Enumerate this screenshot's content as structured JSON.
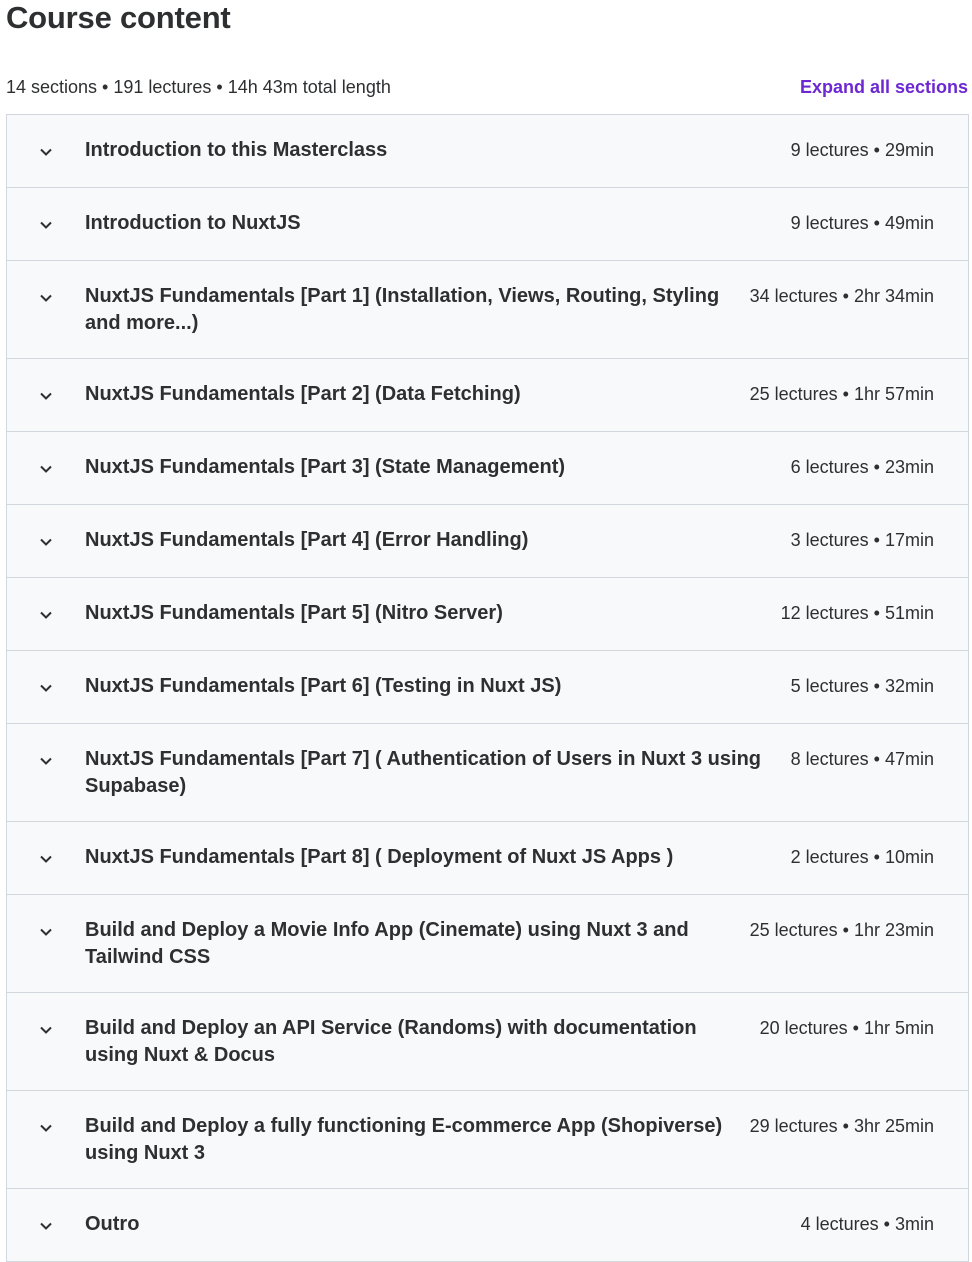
{
  "header": {
    "title": "Course content",
    "summary": "14 sections • 191 lectures • 14h 43m total length",
    "expand_label": "Expand all sections"
  },
  "colors": {
    "accent": "#6d28d2",
    "row_bg": "#f7f9fa",
    "border": "#d1d7dc",
    "text": "#2d2f31"
  },
  "sections": [
    {
      "title": "Introduction to this Masterclass",
      "meta": "9 lectures • 29min"
    },
    {
      "title": "Introduction to NuxtJS",
      "meta": "9 lectures • 49min"
    },
    {
      "title": "NuxtJS Fundamentals [Part 1] (Installation, Views, Routing, Styling and more...)",
      "meta": "34 lectures • 2hr 34min"
    },
    {
      "title": "NuxtJS Fundamentals [Part 2] (Data Fetching)",
      "meta": "25 lectures • 1hr 57min"
    },
    {
      "title": "NuxtJS Fundamentals [Part 3] (State Management)",
      "meta": "6 lectures • 23min"
    },
    {
      "title": "NuxtJS Fundamentals [Part 4] (Error Handling)",
      "meta": "3 lectures • 17min"
    },
    {
      "title": "NuxtJS Fundamentals [Part 5] (Nitro Server)",
      "meta": "12 lectures • 51min"
    },
    {
      "title": "NuxtJS Fundamentals [Part 6] (Testing in Nuxt JS)",
      "meta": "5 lectures • 32min"
    },
    {
      "title": "NuxtJS Fundamentals [Part 7] ( Authentication of Users in Nuxt 3 using Supabase)",
      "meta": "8 lectures • 47min"
    },
    {
      "title": "NuxtJS Fundamentals [Part 8] ( Deployment of Nuxt JS Apps )",
      "meta": "2 lectures • 10min"
    },
    {
      "title": "Build and Deploy a Movie Info App (Cinemate) using Nuxt 3 and Tailwind CSS",
      "meta": "25 lectures • 1hr 23min"
    },
    {
      "title": "Build and Deploy an API Service (Randoms) with documentation using Nuxt & Docus",
      "meta": "20 lectures • 1hr 5min"
    },
    {
      "title": "Build and Deploy a fully functioning E-commerce App (Shopiverse) using Nuxt 3",
      "meta": "29 lectures • 3hr 25min"
    },
    {
      "title": "Outro",
      "meta": "4 lectures • 3min"
    }
  ]
}
